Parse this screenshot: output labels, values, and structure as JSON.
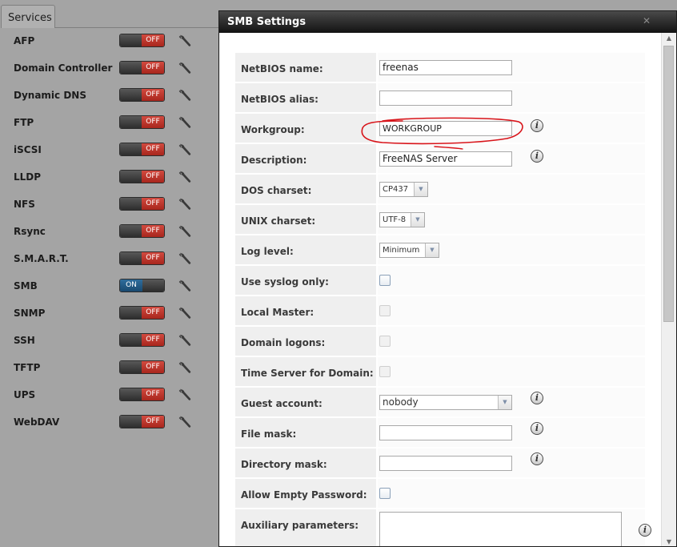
{
  "services_tab": "Services",
  "services": [
    {
      "name": "AFP",
      "state": "OFF"
    },
    {
      "name": "Domain Controller",
      "state": "OFF"
    },
    {
      "name": "Dynamic DNS",
      "state": "OFF"
    },
    {
      "name": "FTP",
      "state": "OFF"
    },
    {
      "name": "iSCSI",
      "state": "OFF"
    },
    {
      "name": "LLDP",
      "state": "OFF"
    },
    {
      "name": "NFS",
      "state": "OFF"
    },
    {
      "name": "Rsync",
      "state": "OFF"
    },
    {
      "name": "S.M.A.R.T.",
      "state": "OFF"
    },
    {
      "name": "SMB",
      "state": "ON"
    },
    {
      "name": "SNMP",
      "state": "OFF"
    },
    {
      "name": "SSH",
      "state": "OFF"
    },
    {
      "name": "TFTP",
      "state": "OFF"
    },
    {
      "name": "UPS",
      "state": "OFF"
    },
    {
      "name": "WebDAV",
      "state": "OFF"
    }
  ],
  "dialog": {
    "title": "SMB Settings",
    "close_glyph": "✕",
    "fields": {
      "netbios_name": {
        "label": "NetBIOS name:",
        "value": "freenas"
      },
      "netbios_alias": {
        "label": "NetBIOS alias:",
        "value": ""
      },
      "workgroup": {
        "label": "Workgroup:",
        "value": "WORKGROUP"
      },
      "description": {
        "label": "Description:",
        "value": "FreeNAS Server"
      },
      "dos_charset": {
        "label": "DOS charset:",
        "value": "CP437"
      },
      "unix_charset": {
        "label": "UNIX charset:",
        "value": "UTF-8"
      },
      "log_level": {
        "label": "Log level:",
        "value": "Minimum"
      },
      "use_syslog": {
        "label": "Use syslog only:",
        "checked": false
      },
      "local_master": {
        "label": "Local Master:",
        "checked": false,
        "disabled": true
      },
      "domain_logons": {
        "label": "Domain logons:",
        "checked": false,
        "disabled": true
      },
      "time_server": {
        "label": "Time Server for Domain:",
        "checked": false,
        "disabled": true
      },
      "guest_account": {
        "label": "Guest account:",
        "value": "nobody"
      },
      "file_mask": {
        "label": "File mask:",
        "value": ""
      },
      "directory_mask": {
        "label": "Directory mask:",
        "value": ""
      },
      "allow_empty_password": {
        "label": "Allow Empty Password:",
        "checked": false
      },
      "auxiliary_parameters": {
        "label": "Auxiliary parameters:",
        "value": ""
      }
    },
    "info_glyph": "i"
  },
  "colors": {
    "toggle_off": "#c0342a",
    "toggle_on": "#245a84",
    "annotation": "#d8141a",
    "titlebar": "#1a1a1a"
  },
  "icons": {
    "service_config": "wrench-icon",
    "help": "info-icon",
    "dropdown": "chevron-down-icon"
  }
}
